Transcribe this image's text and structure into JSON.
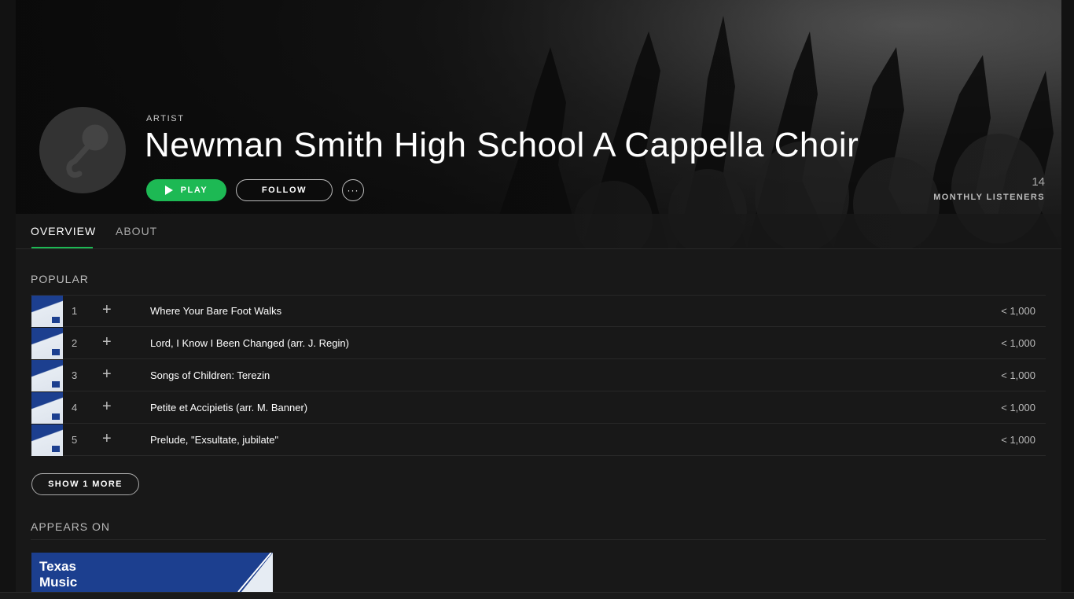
{
  "artist": {
    "label": "ARTIST",
    "name": "Newman Smith High School A Cappella Choir",
    "monthly_listeners_count": "14",
    "monthly_listeners_label": "MONTHLY LISTENERS"
  },
  "actions": {
    "play_label": "PLAY",
    "follow_label": "FOLLOW",
    "more_label": "···"
  },
  "tabs": [
    {
      "label": "OVERVIEW",
      "active": true
    },
    {
      "label": "ABOUT",
      "active": false
    }
  ],
  "popular": {
    "title": "POPULAR",
    "tracks": [
      {
        "num": "1",
        "title": "Where Your Bare Foot Walks",
        "plays": "< 1,000"
      },
      {
        "num": "2",
        "title": "Lord, I Know I Been Changed (arr. J. Regin)",
        "plays": "< 1,000"
      },
      {
        "num": "3",
        "title": "Songs of Children: Terezin",
        "plays": "< 1,000"
      },
      {
        "num": "4",
        "title": "Petite et Accipietis (arr. M. Banner)",
        "plays": "< 1,000"
      },
      {
        "num": "5",
        "title": "Prelude, \"Exsultate, jubilate\"",
        "plays": "< 1,000"
      }
    ],
    "show_more_label": "SHOW 1 MORE"
  },
  "appears_on": {
    "title": "APPEARS ON",
    "album_card_text": "Texas Music"
  },
  "colors": {
    "accent": "#1db954",
    "background": "#181818",
    "album_blue": "#1c3f8f"
  }
}
